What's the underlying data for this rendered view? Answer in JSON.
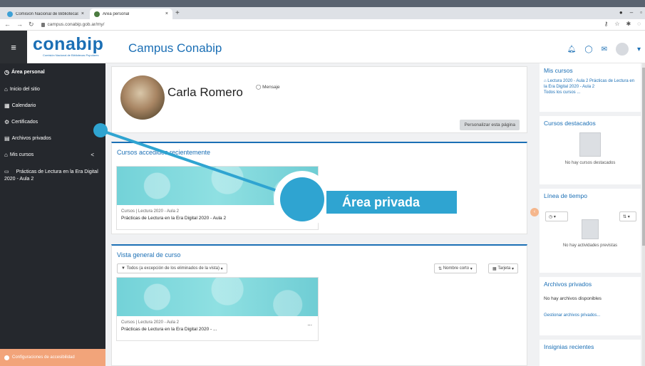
{
  "browser": {
    "tabs": [
      {
        "title": "Comisión Nacional de Bibliotecas",
        "close": "×"
      },
      {
        "title": "Área personal",
        "close": "×"
      }
    ],
    "new_tab": "+",
    "url": "campus.conabip.gob.ar/my/"
  },
  "header": {
    "logo_text": "conabip",
    "logo_subtitle": "Comisión Nacional de Bibliotecas Populares",
    "site_name": "Campus Conabip",
    "menu_glyph": "≡"
  },
  "drawer": {
    "items": [
      {
        "icon": "dashboard-icon",
        "glyph": "◷",
        "label": "Área personal"
      },
      {
        "icon": "home-icon",
        "glyph": "⌂",
        "label": "Inicio del sitio"
      },
      {
        "icon": "calendar-icon",
        "glyph": "▦",
        "label": "Calendario"
      },
      {
        "icon": "certificate-icon",
        "glyph": "⚙",
        "label": "Certificados"
      },
      {
        "icon": "files-icon",
        "glyph": "▤",
        "label": "Archivos privados"
      },
      {
        "icon": "graduation-cap-icon",
        "glyph": "⌂",
        "label": "Mis cursos",
        "chevron": "<"
      },
      {
        "icon": "folder-icon",
        "glyph": "▭",
        "label": "Prácticas de Lectura en la Era Digital 2020 - Aula 2"
      }
    ],
    "accessibility": "Configuraciones de accesibilidad"
  },
  "profile": {
    "name": "Carla Romero",
    "message": "Mensaje",
    "customize": "Personalizar esta página"
  },
  "recent": {
    "title": "Cursos accedidos recientemente",
    "course": {
      "category": "Cursos | Lectura 2020 - Aula 2",
      "name": "Prácticas de Lectura en la Era Digital 2020 - Aula 2"
    }
  },
  "overview": {
    "title": "Vista general de curso",
    "filter": "Todos (a excepción de los eliminados de la vista)",
    "sort": "Nombre corto",
    "view": "Tarjeta",
    "course": {
      "category": "Cursos | Lectura 2020 - Aula 2",
      "name": "Prácticas de Lectura en la Era Digital 2020 - ...",
      "menu": "..."
    }
  },
  "right": {
    "my_courses": {
      "title": "Mis cursos",
      "course": "Lectura 2020 - Aula 2 Prácticas de Lectura en la Era Digital 2020 - Aula 2",
      "all": "Todos los cursos ..."
    },
    "starred": {
      "title": "Cursos destacados",
      "empty": "No hay cursos destacados"
    },
    "timeline": {
      "title": "Línea de tiempo",
      "empty": "No hay actividades previstas"
    },
    "private_files": {
      "title": "Archivos privados",
      "empty": "No hay archivos disponibles",
      "manage": "Gestionar archivos privados..."
    },
    "badges": {
      "title": "Insignias recientes"
    }
  },
  "callout": {
    "label": "Área privada"
  },
  "colors": {
    "brand": "#1b6fb5",
    "drawer": "#25282d",
    "callout": "#2fa4d1",
    "accessibility": "#f2a47a"
  }
}
